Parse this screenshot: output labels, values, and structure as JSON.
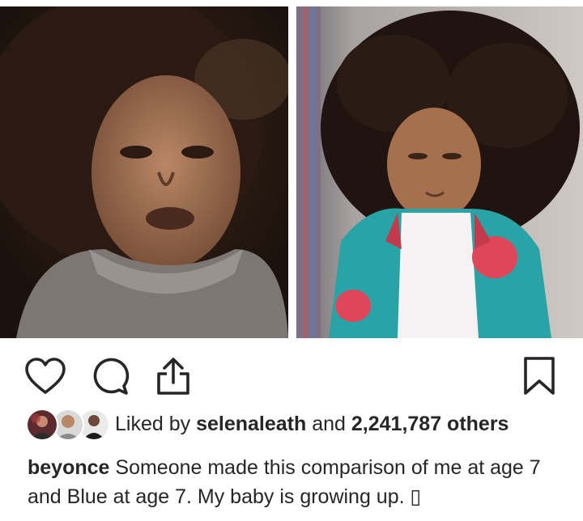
{
  "post": {
    "photos": [
      {
        "name": "photo-age-7-left"
      },
      {
        "name": "photo-age-7-right"
      }
    ],
    "actions": {
      "like": "heart-icon",
      "comment": "comment-icon",
      "share": "share-icon",
      "save": "bookmark-icon"
    },
    "likes": {
      "prefix": "Liked by",
      "user": "selenaleath",
      "joiner": "and",
      "count": "2,241,787 others"
    },
    "caption": {
      "username": "beyonce",
      "text": "Someone made this comparison of me at age 7 and Blue at age 7. My baby is growing up. ▯"
    }
  },
  "colors": {
    "text": "#262626",
    "background": "#ffffff",
    "icon_stroke": "#262626"
  }
}
